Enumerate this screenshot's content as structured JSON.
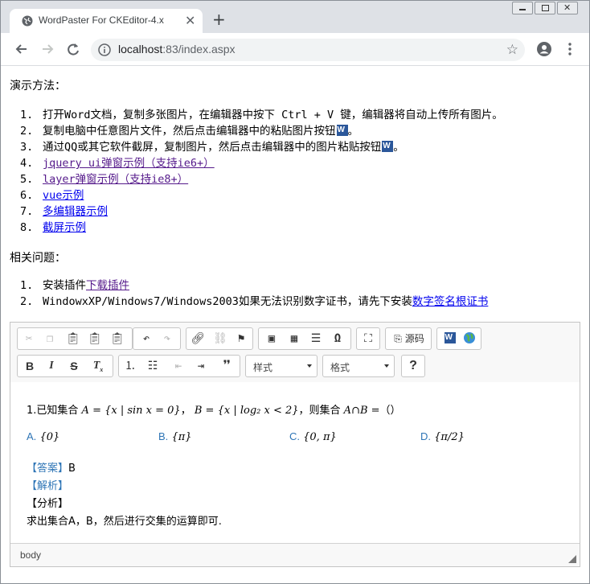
{
  "browser": {
    "tab_title": "WordPaster For CKEditor-4.x",
    "url_host": "localhost",
    "url_rest": ":83/index.aspx"
  },
  "demo": {
    "heading": "演示方法：",
    "items": [
      {
        "num": "1.",
        "text": "打开Word文档，复制多张图片，在编辑器中按下 Ctrl + V 键，编辑器将自动上传所有图片。"
      },
      {
        "num": "2.",
        "text": "复制电脑中任意图片文件，然后点击编辑器中的粘贴图片按钮",
        "suffix": "。"
      },
      {
        "num": "3.",
        "text": "通过QQ或其它软件截屏，复制图片，然后点击编辑器中的图片粘贴按钮",
        "suffix": "。"
      },
      {
        "num": "4.",
        "link": "jquery ui弹窗示例（支持ie6+）"
      },
      {
        "num": "5.",
        "link": "layer弹窗示例（支持ie8+）"
      },
      {
        "num": "6.",
        "link": "vue示例"
      },
      {
        "num": "7.",
        "link": "多编辑器示例"
      },
      {
        "num": "8.",
        "link": "截屏示例"
      }
    ]
  },
  "related": {
    "heading": "相关问题：",
    "items": [
      {
        "num": "1.",
        "text": "安装插件",
        "link": "下载插件"
      },
      {
        "num": "2.",
        "text": "WindowxXP/Windows7/Windows2003如果无法识别数字证书，请先下安装",
        "link": "数字签名根证书"
      }
    ]
  },
  "editor": {
    "style_combo": "样式",
    "format_combo": "格式",
    "source_label": "源码",
    "help_label": "?",
    "footer_path": "body",
    "question": {
      "prefix": "1.已知集合",
      "set_a": "A = {x | sin x = 0}",
      "sep": "，",
      "set_b": "B = {x | log₂ x < 2}",
      "tail": "，则集合",
      "expr": "A∩B =",
      "paren": "（）"
    },
    "options": [
      {
        "label": "A.",
        "value": "{0}"
      },
      {
        "label": "B.",
        "value": "{π}"
      },
      {
        "label": "C.",
        "value": "{0, π}"
      },
      {
        "label": "D.",
        "value": "{π/2}"
      }
    ],
    "answer_label": "【答案】",
    "answer_value": "B",
    "analysis_label": "【解析】",
    "fenxi_label": "【分析】",
    "fenxi_text": "求出集合A，B，然后进行交集的运算即可."
  }
}
